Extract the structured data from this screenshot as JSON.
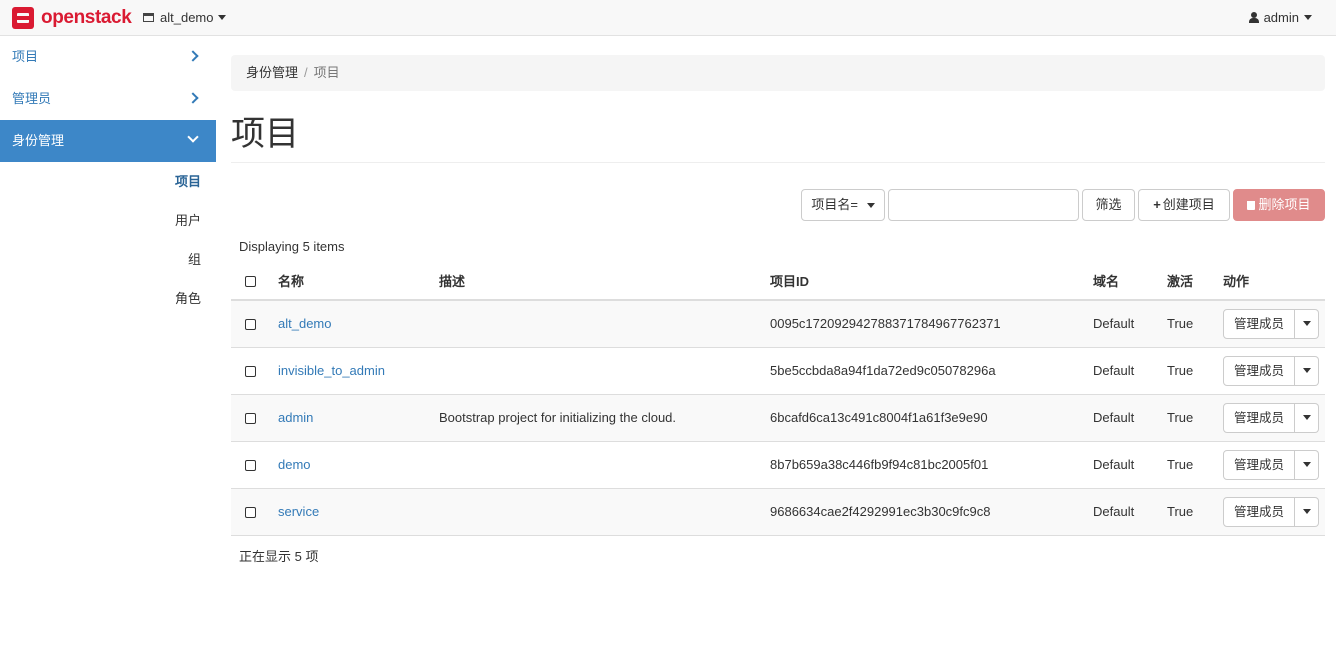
{
  "brand": {
    "name": "openstack",
    "color": "#da1a32"
  },
  "header": {
    "project": "alt_demo",
    "user": "admin"
  },
  "sidebar": {
    "panels": [
      {
        "label": "项目"
      },
      {
        "label": "管理员"
      },
      {
        "label": "身份管理",
        "active": true
      }
    ],
    "sub_items": [
      {
        "label": "项目",
        "active": true
      },
      {
        "label": "用户"
      },
      {
        "label": "组"
      },
      {
        "label": "角色"
      }
    ]
  },
  "breadcrumb": {
    "first": "身份管理",
    "separator": "/",
    "last": "项目"
  },
  "page": {
    "title": "项目"
  },
  "toolbar": {
    "filter_field": "项目名=",
    "filter_value": "",
    "filter_button": "筛选",
    "create_button": "创建项目",
    "delete_button": "删除项目"
  },
  "table": {
    "count_top": "Displaying 5 items",
    "count_bottom": "正在显示 5 项",
    "columns": {
      "name": "名称",
      "description": "描述",
      "id": "项目ID",
      "domain": "域名",
      "enabled": "激活",
      "actions": "动作"
    },
    "rows": [
      {
        "name": "alt_demo",
        "description": "",
        "id": "0095c1720929427883717849677623 71",
        "domain": "Default",
        "enabled": "True",
        "action": "管理成员"
      },
      {
        "name": "invisible_to_admin",
        "description": "",
        "id": "5be5ccbda8a94f1da72ed9c05078296a",
        "domain": "Default",
        "enabled": "True",
        "action": "管理成员"
      },
      {
        "name": "admin",
        "description": "Bootstrap project for initializing the cloud.",
        "id": "6bcafd6ca13c491c8004f1a61f3e9e90",
        "domain": "Default",
        "enabled": "True",
        "action": "管理成员"
      },
      {
        "name": "demo",
        "description": "",
        "id": "8b7b659a38c446fb9f94c81bc2005f01",
        "domain": "Default",
        "enabled": "True",
        "action": "管理成员"
      },
      {
        "name": "service",
        "description": "",
        "id": "9686634cae2f4292991ec3b30c9fc9c8",
        "domain": "Default",
        "enabled": "True",
        "action": "管理成员"
      }
    ]
  },
  "colors": {
    "accent": "#337ab7",
    "sidebar_active": "#3d87c8",
    "danger": "#e08b8b"
  }
}
